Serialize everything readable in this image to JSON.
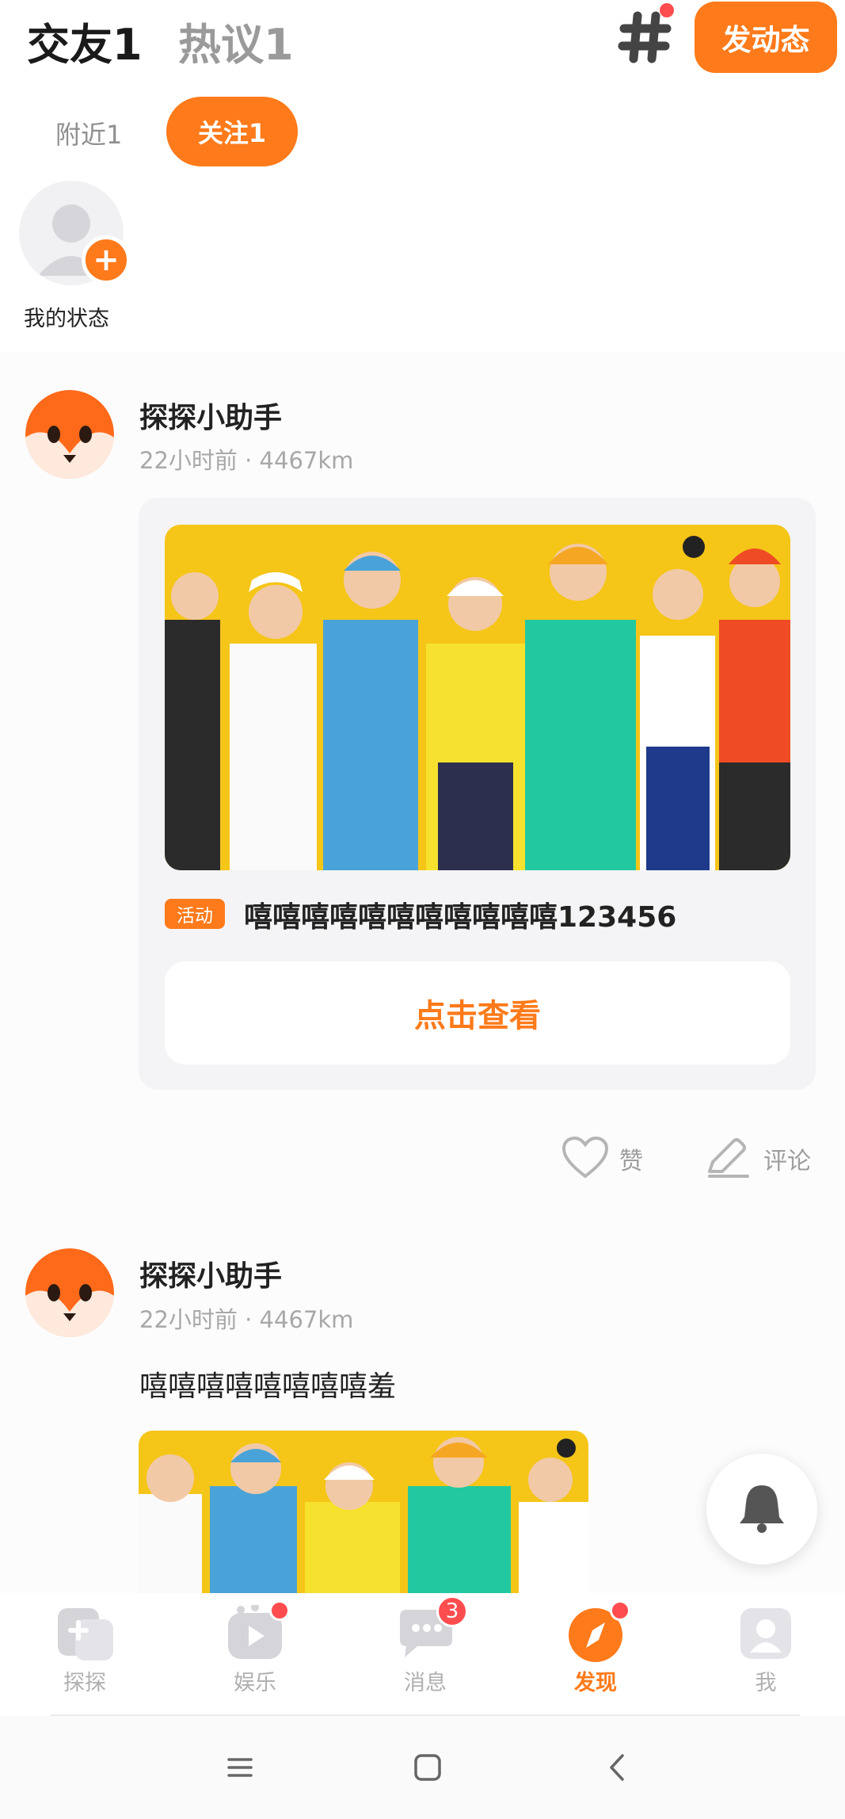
{
  "header": {
    "tab_friends": "交友1",
    "tab_hot": "热议1",
    "post_button": "发动态"
  },
  "subtabs": {
    "nearby": "附近1",
    "following": "关注1"
  },
  "my_status": {
    "label": "我的状态"
  },
  "posts": [
    {
      "author": "探探小助手",
      "meta": "22小时前 · 4467km",
      "tag": "活动",
      "activity_text": "嘻嘻嘻嘻嘻嘻嘻嘻嘻嘻嘻123456",
      "view_button": "点击查看",
      "like_label": "赞",
      "comment_label": "评论"
    },
    {
      "author": "探探小助手",
      "meta": "22小时前 · 4467km",
      "text": "嘻嘻嘻嘻嘻嘻嘻嘻羞"
    }
  ],
  "bottom_nav": [
    {
      "label": "探探",
      "icon": "tantan-icon",
      "active": false
    },
    {
      "label": "娱乐",
      "icon": "play-icon",
      "active": false,
      "dot": true
    },
    {
      "label": "消息",
      "icon": "message-icon",
      "active": false,
      "badge": "3"
    },
    {
      "label": "发现",
      "icon": "discover-icon",
      "active": true,
      "dot": true
    },
    {
      "label": "我",
      "icon": "profile-icon",
      "active": false
    }
  ],
  "colors": {
    "accent": "#ff7a1a",
    "badge": "#ff4d4f"
  }
}
